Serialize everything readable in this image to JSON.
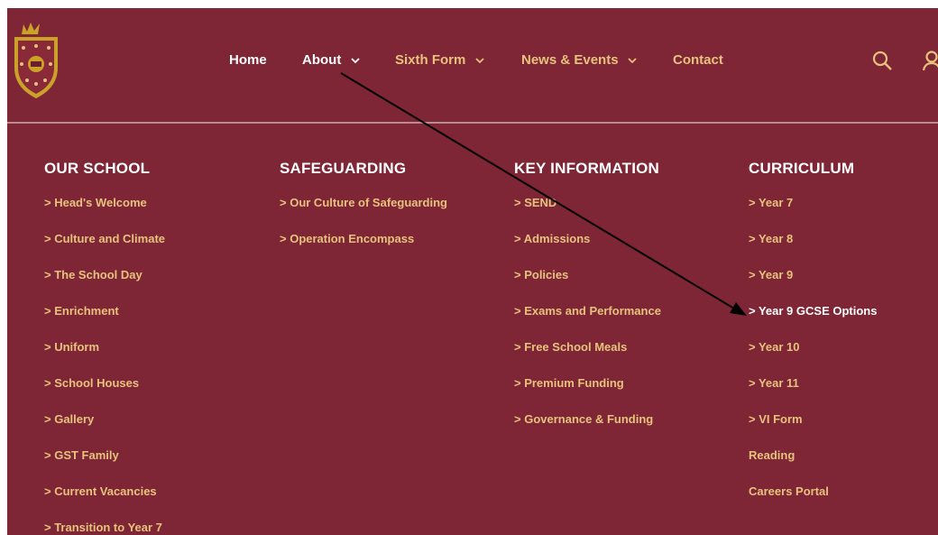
{
  "nav": {
    "items": [
      {
        "label": "Home",
        "has_dropdown": false,
        "active": false
      },
      {
        "label": "About",
        "has_dropdown": true,
        "active": true
      },
      {
        "label": "Sixth Form",
        "has_dropdown": true,
        "active": false
      },
      {
        "label": "News & Events",
        "has_dropdown": true,
        "active": false
      },
      {
        "label": "Contact",
        "has_dropdown": false,
        "active": false
      }
    ],
    "icons": [
      "search-icon",
      "user-icon"
    ]
  },
  "menu": {
    "columns": [
      {
        "heading": "OUR SCHOOL",
        "links": [
          "> Head's Welcome",
          "> Culture and Climate",
          "> The School Day",
          "> Enrichment",
          "> Uniform",
          "> School Houses",
          "> Gallery",
          "> GST Family",
          "> Current Vacancies",
          "> Transition to Year 7"
        ]
      },
      {
        "heading": "SAFEGUARDING",
        "links": [
          "> Our Culture of Safeguarding",
          "> Operation Encompass"
        ]
      },
      {
        "heading": "KEY INFORMATION",
        "links": [
          "> SEND",
          "> Admissions",
          "> Policies",
          "> Exams and Performance",
          "> Free School Meals",
          "> Premium Funding",
          "> Governance & Funding"
        ]
      },
      {
        "heading": "CURRICULUM",
        "links": [
          "> Year 7",
          "> Year 8",
          "> Year 9",
          "> Year 9 GCSE Options",
          "> Year 10",
          "> Year 11",
          "> VI Form",
          "Reading",
          "Careers Portal"
        ]
      }
    ]
  },
  "colors": {
    "background": "#7f2636",
    "link_gold": "#e6c27c",
    "heading_white": "#ffffff",
    "arrow": "#000000"
  }
}
